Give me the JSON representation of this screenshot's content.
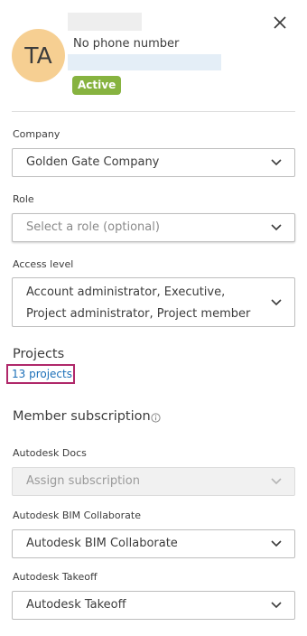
{
  "user": {
    "initials": "TA",
    "phone": "No phone number",
    "status": "Active"
  },
  "company": {
    "label": "Company",
    "value": "Golden Gate Company"
  },
  "role": {
    "label": "Role",
    "placeholder": "Select a role (optional)"
  },
  "access": {
    "label": "Access level",
    "line1": "Account administrator,  Executive,",
    "line2": "Project administrator,  Project member"
  },
  "projects": {
    "title": "Projects",
    "link": "13 projects"
  },
  "subscription": {
    "title": "Member subscription",
    "docs_label": "Autodesk Docs",
    "docs_placeholder": "Assign subscription",
    "bim_label": "Autodesk BIM Collaborate",
    "bim_value": "Autodesk BIM Collaborate",
    "takeoff_label": "Autodesk Takeoff",
    "takeoff_value": "Autodesk Takeoff"
  },
  "colors": {
    "avatar": "#f6cf92",
    "active_badge": "#87b340",
    "link": "#1b6fb8",
    "highlight": "#b0286a"
  },
  "icons": [
    "close-icon",
    "chevron-down-icon",
    "info-icon"
  ]
}
